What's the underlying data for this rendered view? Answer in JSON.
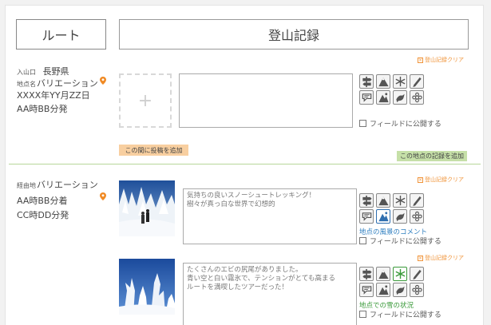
{
  "header": {
    "route_tab": "ルート",
    "title": "登山記録"
  },
  "section1": {
    "entrance_label": "入山口",
    "entrance_value": "長野県",
    "point_label": "地点名",
    "point_value": "バリエーション",
    "date": "XXXX年YY月ZZ日",
    "time": "AA時BB分発",
    "clear_label": "登山記録クリア",
    "photo_placeholder": "+",
    "text_value": "",
    "publish_label": "フィールドに公開する",
    "add_between": "この間に投稿を追加",
    "add_point": "この地点の記録を追加"
  },
  "section2": {
    "point_label": "経由地",
    "point_value": "バリエーション",
    "arrive": "AA時BB分着",
    "depart": "CC時DD分発",
    "post1": {
      "clear_label": "登山記録クリア",
      "text_value": "気持ちの良いスノーシュートレッキング！\n樹々が真っ白な世界で幻想的",
      "caption": "地点の風景のコメント",
      "publish_label": "フィールドに公開する"
    },
    "post2": {
      "clear_label": "登山記録クリア",
      "text_value": "たくさんのエビの尻尾がありました。\n青い空と白い霧氷で、テンションがとても高まる\nルートを満喫したツアーだった！",
      "caption": "地点での雪の状況",
      "publish_label": "フィールドに公開する"
    }
  },
  "icons": [
    "signpost-icon",
    "mountain-icon",
    "snowflake-icon",
    "pencil-icon",
    "talk-icon",
    "hikers-icon",
    "bird-icon",
    "flower-icon"
  ],
  "colors": {
    "accent_orange": "#f0943a",
    "pin_orange": "#f08a24",
    "divider_green": "#b7d69a",
    "add_green": "#c6e0a8",
    "add_orange": "#f8cfa0",
    "blue": "#2f7fc0",
    "green": "#3a9a3a"
  }
}
